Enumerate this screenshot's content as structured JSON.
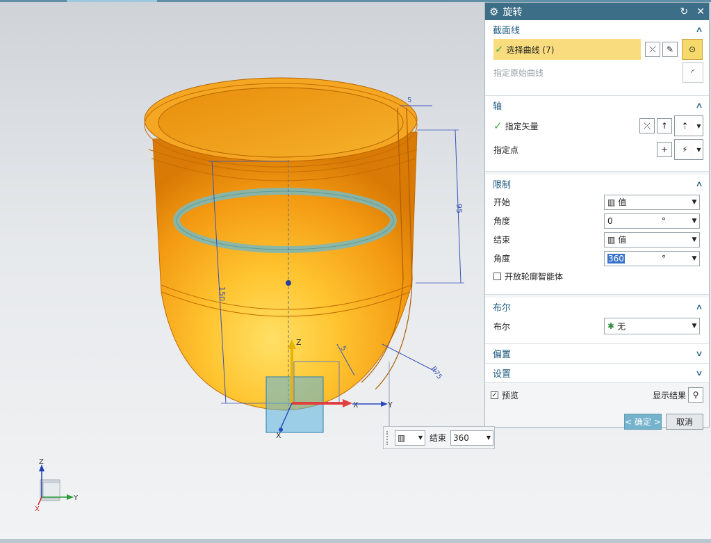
{
  "dialog": {
    "title": "旋转",
    "section_curve": {
      "title": "截面线",
      "select_curve_label": "选择曲线 (7)",
      "specify_original_curve": "指定原始曲线"
    },
    "section_axis": {
      "title": "轴",
      "specify_vector": "指定矢量",
      "specify_point": "指定点"
    },
    "section_limits": {
      "title": "限制",
      "start_label": "开始",
      "start_value": "值",
      "start_angle_label": "角度",
      "start_angle_value": "0",
      "end_label": "结束",
      "end_value": "值",
      "end_angle_label": "角度",
      "end_angle_value": "360",
      "degree_unit": "°",
      "open_profile_label": "开放轮廓智能体"
    },
    "section_boolean": {
      "title": "布尔",
      "label": "布尔",
      "value": "无"
    },
    "section_offset": {
      "title": "偏置"
    },
    "section_settings": {
      "title": "设置"
    },
    "preview_label": "预览",
    "show_result_label": "显示结果",
    "ok_button": "< 确定 >",
    "cancel_button": "取消"
  },
  "floatbar": {
    "end_label": "结束",
    "end_value": "360"
  },
  "dimensions": {
    "d1": "5",
    "d2": "95",
    "d3": "150",
    "d4": "5",
    "d5": "R75"
  },
  "axes": {
    "x": "X",
    "y": "Y",
    "z": "Z"
  },
  "colors": {
    "title_bar": "#3d6e88",
    "section_title": "#1d5a7f",
    "selection_highlight": "#f8dc7e",
    "model_orange": "#f3a020",
    "ok_button": "#75b2cc"
  }
}
